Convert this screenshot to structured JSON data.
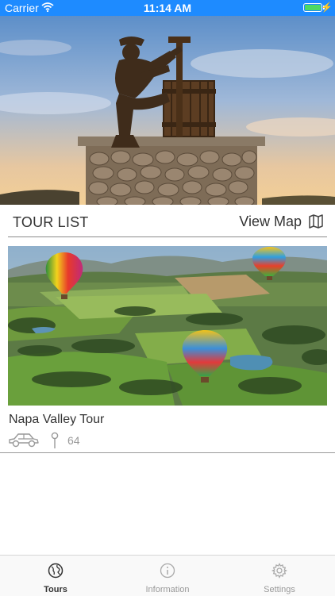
{
  "status_bar": {
    "carrier": "Carrier",
    "time": "11:14 AM"
  },
  "hero": {
    "image_name": "grape-crusher-statue"
  },
  "tour_list": {
    "title": "TOUR LIST",
    "view_map_label": "View Map"
  },
  "tours": [
    {
      "name": "Napa Valley Tour",
      "stops": "64",
      "image_name": "hot-air-balloons-over-vineyards"
    }
  ],
  "tab_bar": {
    "items": [
      {
        "label": "Tours",
        "icon": "globe-icon",
        "active": true
      },
      {
        "label": "Information",
        "icon": "info-icon",
        "active": false
      },
      {
        "label": "Settings",
        "icon": "gear-icon",
        "active": false
      }
    ]
  },
  "colors": {
    "status_bar": "#1e8bff",
    "battery": "#4cd964",
    "text": "#333333",
    "muted": "#999999"
  }
}
